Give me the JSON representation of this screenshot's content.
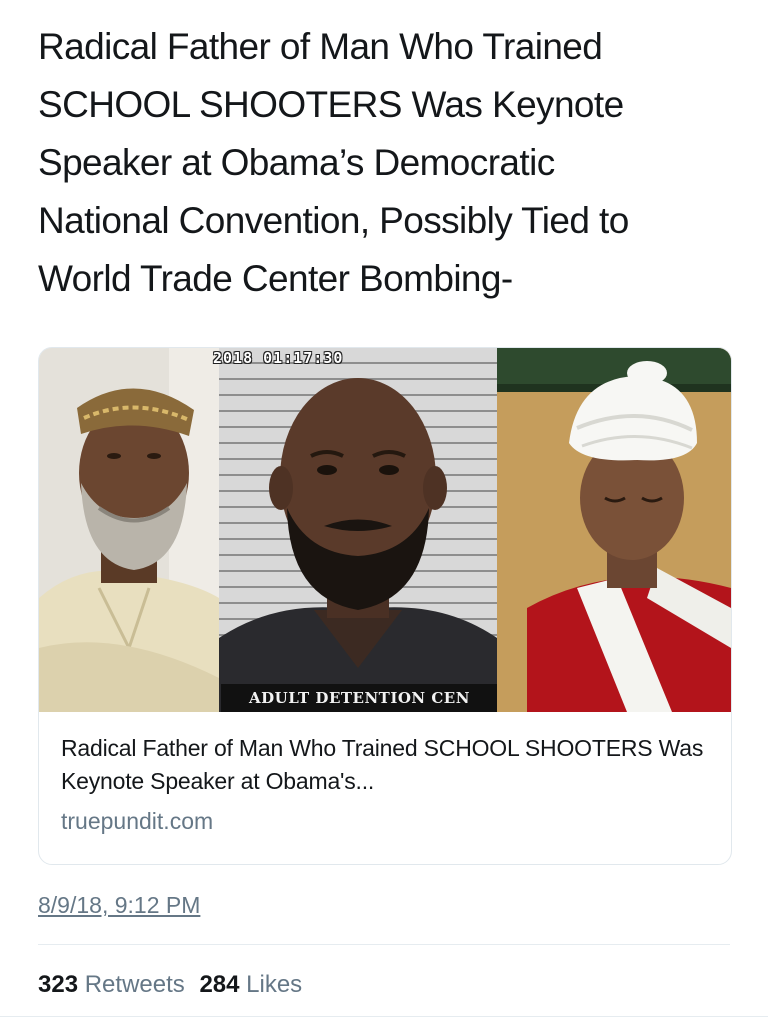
{
  "tweet": {
    "text": "Radical Father of Man Who Trained\nSCHOOL SHOOTERS Was Keynote\nSpeaker at Obama’s Democratic\nNational Convention, Possibly Tied to\nWorld Trade Center Bombing-"
  },
  "card": {
    "image": {
      "panels": [
        "older-man-in-kufi-photo",
        "mugshot-photo",
        "man-in-white-turban-photo"
      ],
      "stamp": "2018 01:17:30",
      "caption": "ADULT DETENTION CEN"
    },
    "title": "Radical Father of Man Who Trained SCHOOL SHOOTERS Was Keynote Speaker at Obama's...",
    "domain": "truepundit.com"
  },
  "timestamp": "8/9/18, 9:12 PM",
  "stats": {
    "retweets_count": "323",
    "retweets_label": "Retweets",
    "likes_count": "284",
    "likes_label": "Likes"
  },
  "colors": {
    "text": "#14171a",
    "secondary": "#657786",
    "border": "#e1e8ed"
  }
}
